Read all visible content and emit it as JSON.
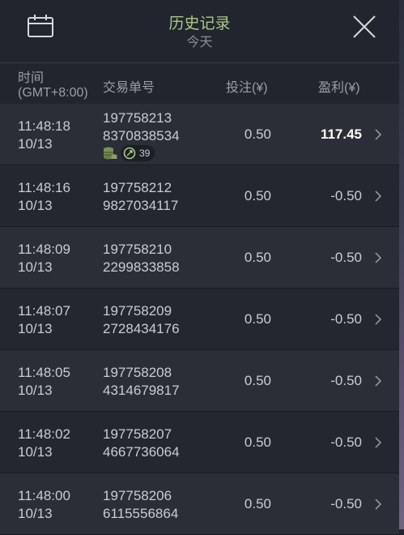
{
  "header": {
    "title": "历史记录",
    "subtitle": "今天"
  },
  "columns": {
    "time": "时间",
    "timezone": "(GMT+8:00)",
    "order": "交易单号",
    "bet": "投注(¥)",
    "profit": "盈利(¥)"
  },
  "rows": [
    {
      "time": "11:48:18",
      "date": "10/13",
      "order1": "197758213",
      "order2": "8370838534",
      "bet": "0.50",
      "profit": "117.45",
      "badge_count": "39"
    },
    {
      "time": "11:48:16",
      "date": "10/13",
      "order1": "197758212",
      "order2": "9827034117",
      "bet": "0.50",
      "profit": "-0.50"
    },
    {
      "time": "11:48:09",
      "date": "10/13",
      "order1": "197758210",
      "order2": "2299833858",
      "bet": "0.50",
      "profit": "-0.50"
    },
    {
      "time": "11:48:07",
      "date": "10/13",
      "order1": "197758209",
      "order2": "2728434176",
      "bet": "0.50",
      "profit": "-0.50"
    },
    {
      "time": "11:48:05",
      "date": "10/13",
      "order1": "197758208",
      "order2": "4314679817",
      "bet": "0.50",
      "profit": "-0.50"
    },
    {
      "time": "11:48:02",
      "date": "10/13",
      "order1": "197758207",
      "order2": "4667736064",
      "bet": "0.50",
      "profit": "-0.50"
    },
    {
      "time": "11:48:00",
      "date": "10/13",
      "order1": "197758206",
      "order2": "6115556864",
      "bet": "0.50",
      "profit": "-0.50"
    }
  ],
  "colors": {
    "accent": "#a7c98a",
    "background": "#20232b",
    "row_alt": "#2b2e36"
  }
}
